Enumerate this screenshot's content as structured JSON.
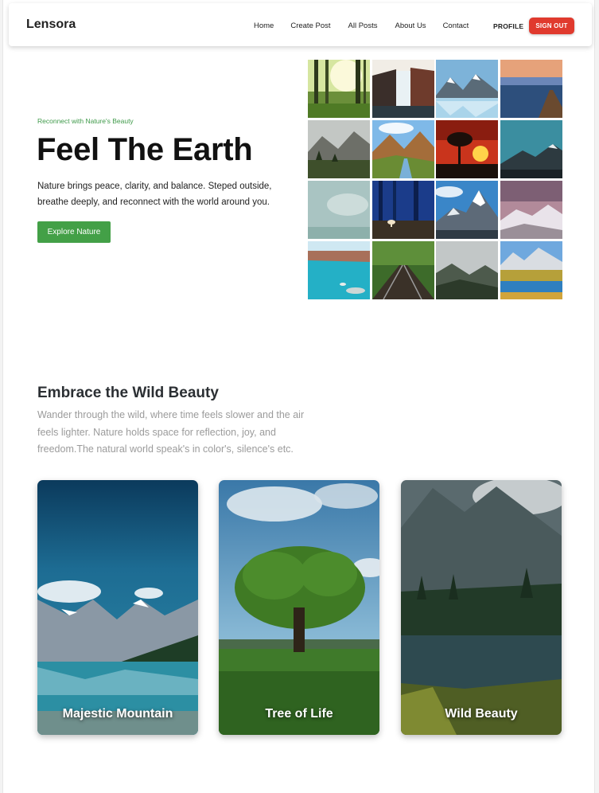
{
  "nav": {
    "brand": "Lensora",
    "links": [
      "Home",
      "Create Post",
      "All Posts",
      "About Us",
      "Contact"
    ],
    "profile": "PROFILE",
    "signout": "SIGN OUT"
  },
  "hero": {
    "tagline": "Reconnect with Nature's Beauty",
    "title": "Feel The Earth",
    "description": "Nature brings peace, clarity, and balance. Steped outside, breathe deeply, and reconnect with the world around you.",
    "button": "Explore Nature"
  },
  "gallery": [
    "forest-sunlight-photo",
    "waterfall-photo",
    "snowy-mountain-lake-photo",
    "lake-pier-sunset-photo",
    "mountain-valley-photo",
    "river-valley-photo",
    "sunset-tree-photo",
    "dark-mountain-photo",
    "misty-fog-photo",
    "blue-forest-mushroom-photo",
    "snow-peak-photo",
    "pink-sky-mountain-photo",
    "turquoise-coast-photo",
    "forest-railway-photo",
    "foggy-hills-photo",
    "mountain-meadow-lake-photo"
  ],
  "section": {
    "title": "Embrace the Wild Beauty",
    "description": "Wander through the wild, where time feels slower and the air feels lighter. Nature holds space for reflection, joy, and freedom.The natural world speak's in color's, silence's etc."
  },
  "cards": [
    {
      "label": "Majestic Mountain"
    },
    {
      "label": "Tree of Life"
    },
    {
      "label": "Wild Beauty"
    }
  ],
  "colors": {
    "accent_green": "#43a047",
    "signout_red": "#e03a2e",
    "tagline_green": "#3f9a4a"
  }
}
